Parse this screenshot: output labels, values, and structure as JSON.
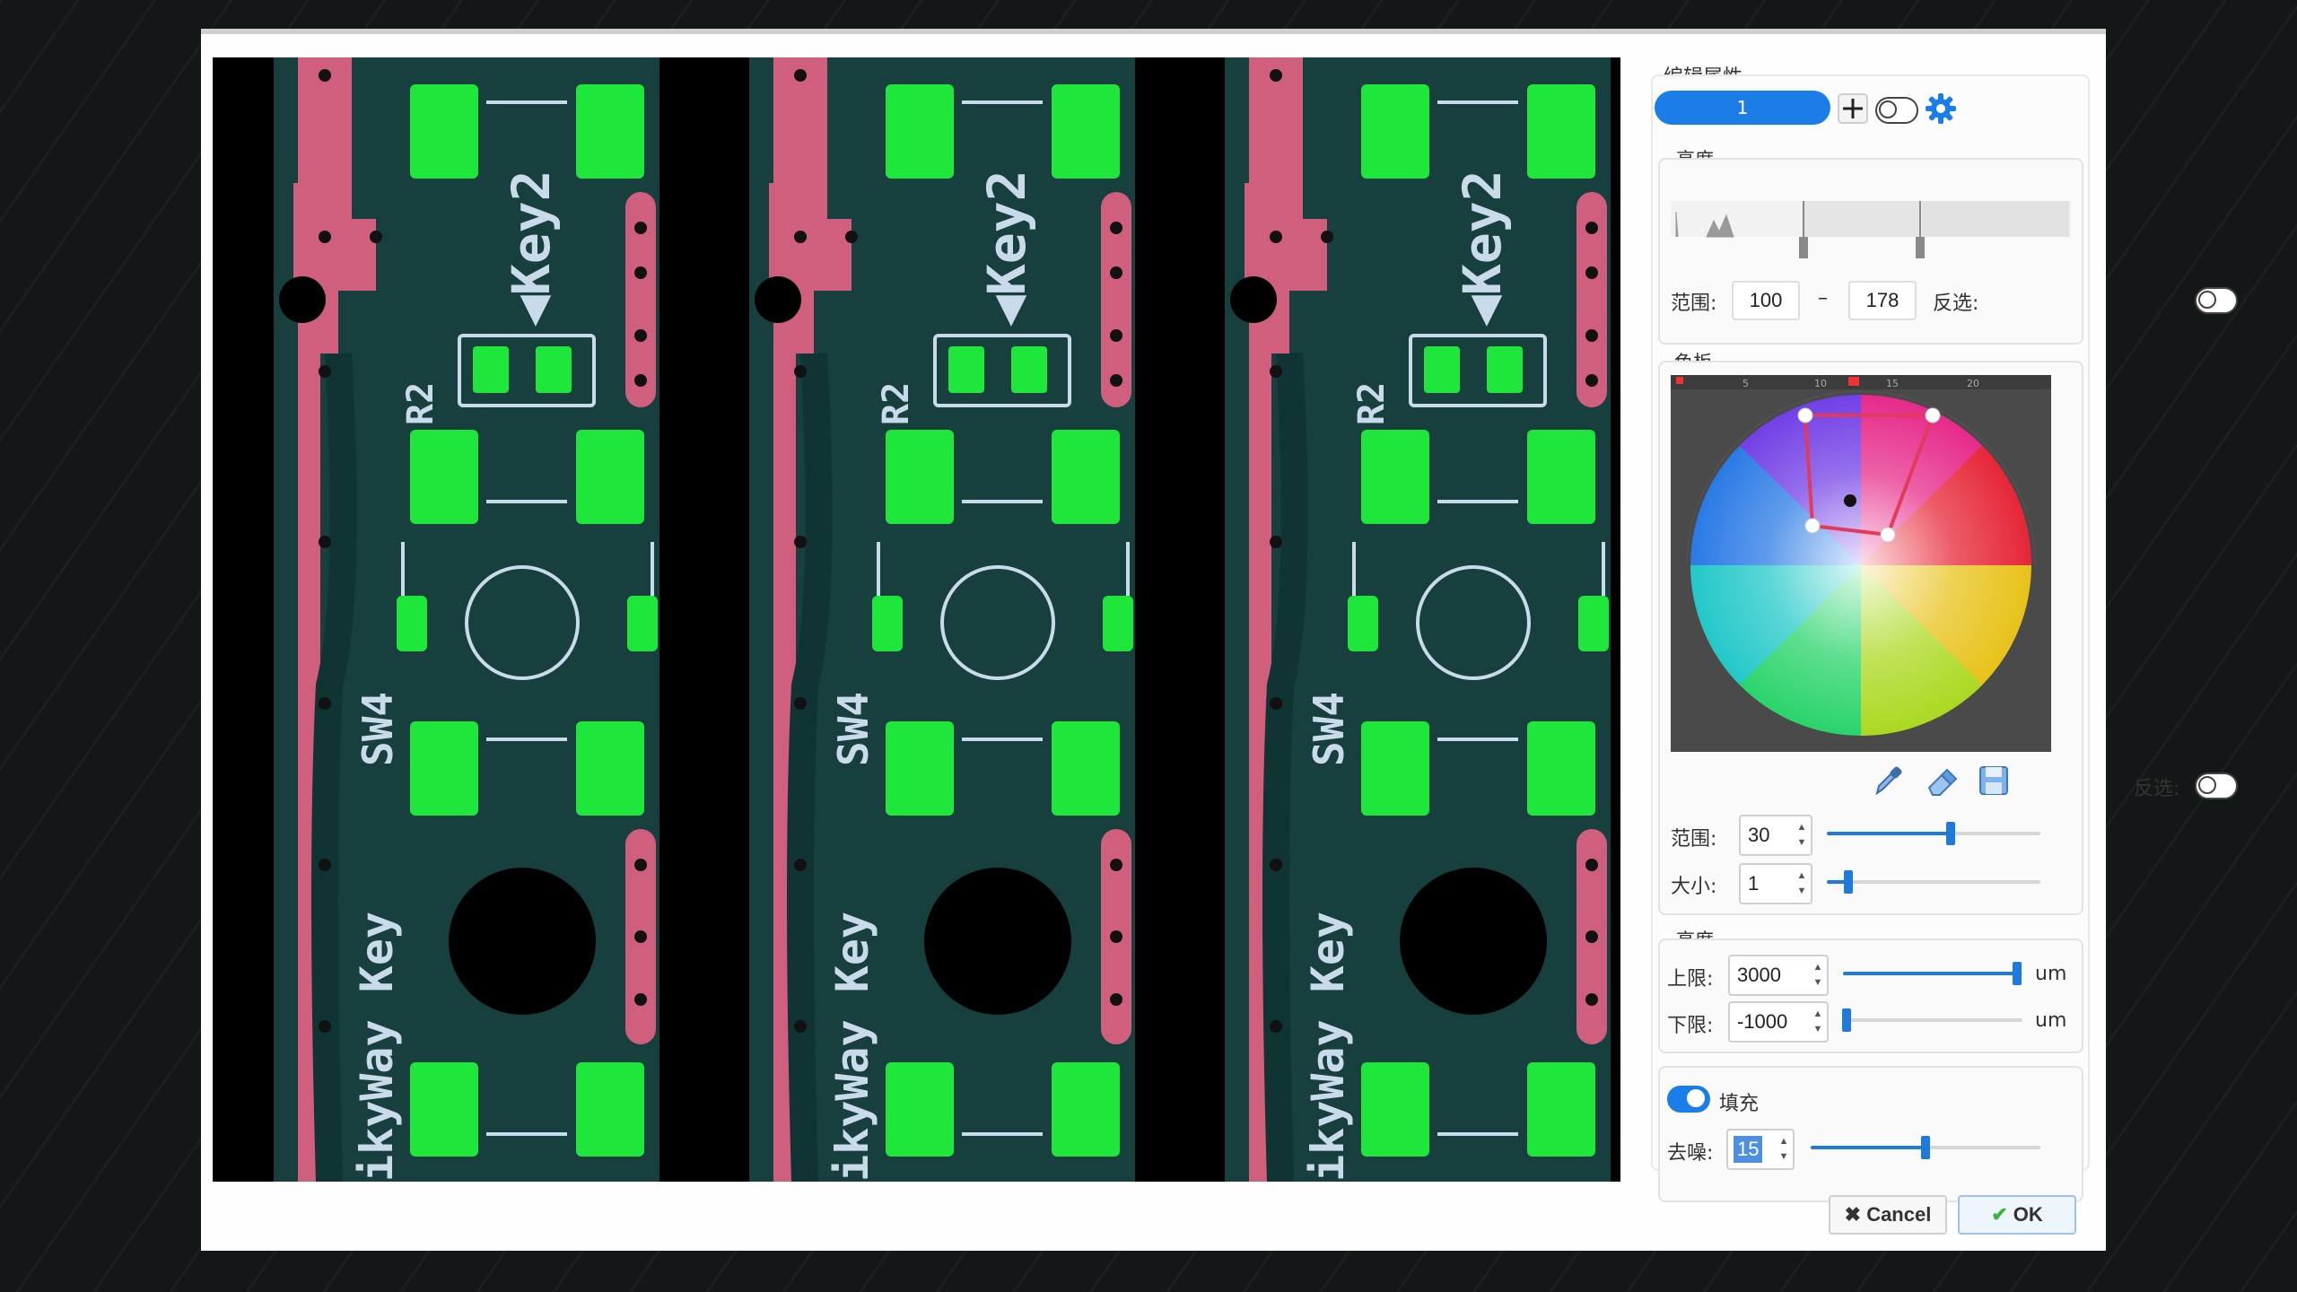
{
  "dialog": {
    "ok_label": "OK",
    "cancel_label": "Cancel"
  },
  "board": {
    "labels": [
      "Key2",
      "R2",
      "SW4",
      "kyWay Key"
    ],
    "colors": {
      "substrate": "#163f3e",
      "trace": "#d05f7e",
      "highlight": "#1ee63a",
      "silk": "#c9dbea"
    }
  },
  "properties": {
    "title": "编辑属性",
    "layer_value": "1",
    "add_icon": "plus-icon",
    "settings_icon": "gear-icon",
    "brightness": {
      "title": "亮度",
      "range_label": "范围:",
      "min": "100",
      "separator": "–",
      "max": "178",
      "invert_label": "反选:"
    },
    "color_palette": {
      "title": "色板",
      "invert_label": "反选:",
      "range_label": "范围:",
      "range_value": "30",
      "range_slider": 0.58,
      "size_label": "大小:",
      "size_value": "1",
      "size_slider": 0.1,
      "tools": [
        "eyedropper-icon",
        "eraser-icon",
        "save-icon"
      ]
    },
    "height": {
      "title": "高度",
      "upper_label": "上限:",
      "upper_value": "3000",
      "upper_slider": 0.97,
      "lower_label": "下限:",
      "lower_value": "-1000",
      "lower_slider": 0.02,
      "unit": "um"
    },
    "fill": {
      "label": "填充",
      "enabled": true,
      "denoise_label": "去噪:",
      "denoise_value": "15",
      "denoise_slider": 0.5
    }
  },
  "accent_color": "#1a7de8"
}
